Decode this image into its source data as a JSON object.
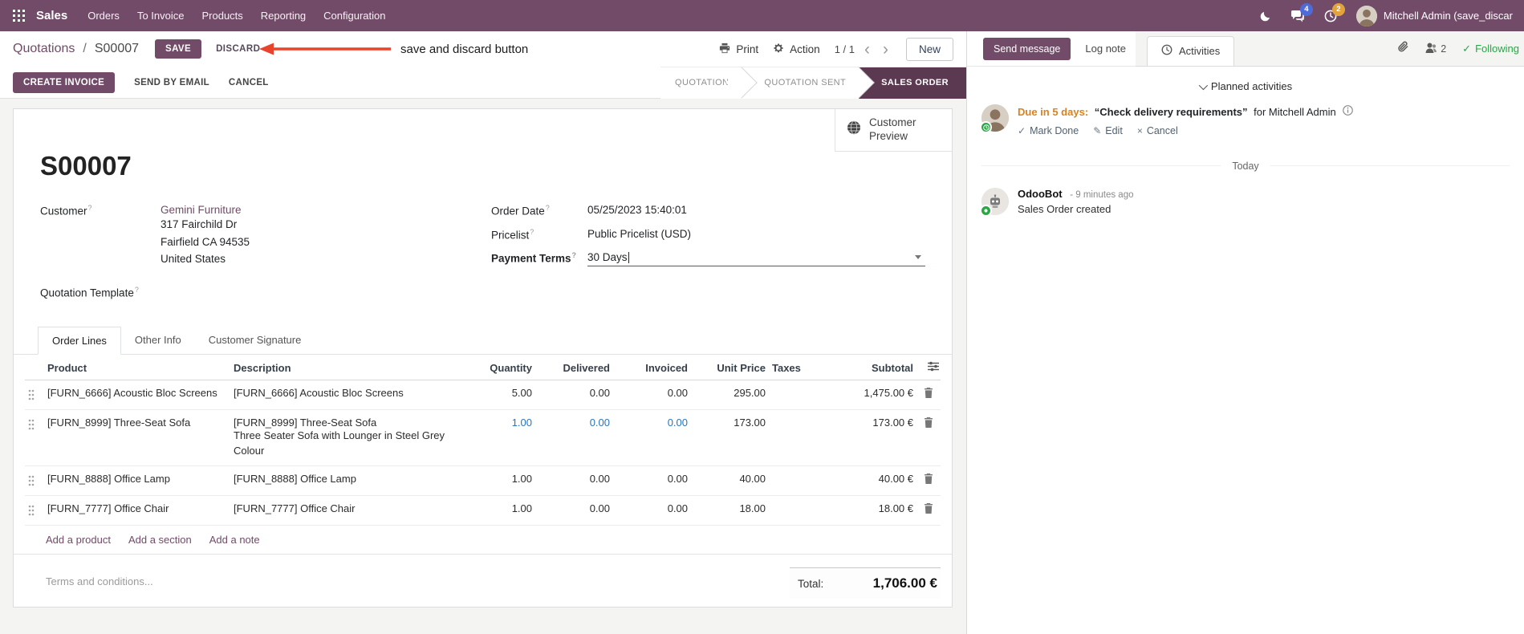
{
  "colors": {
    "brand": "#714B67",
    "brandDark": "#5B3A51",
    "link": "#714B67",
    "modifiedBlue": "#2A75BB",
    "dueOrange": "#D9831F",
    "successGreen": "#28A745",
    "annotationRed": "#E8432D",
    "badgeBlue": "#4E6BD8",
    "badgeOrange": "#E2A33D"
  },
  "nav": {
    "brand": "Sales",
    "menus": [
      "Orders",
      "To Invoice",
      "Products",
      "Reporting",
      "Configuration"
    ],
    "badges": {
      "messages": "4",
      "activities": "2"
    },
    "user": "Mitchell Admin (save_discar"
  },
  "control": {
    "breadcrumb_parent": "Quotations",
    "breadcrumb_sep": "/",
    "breadcrumb_current": "S00007",
    "save": "SAVE",
    "discard": "DISCARD",
    "annotation": "save and discard button",
    "print": "Print",
    "action": "Action",
    "pager": "1 / 1",
    "new": "New"
  },
  "statusbar": {
    "buttons": [
      "CREATE INVOICE",
      "SEND BY EMAIL",
      "CANCEL"
    ],
    "steps": [
      {
        "label": "QUOTATION",
        "active": false
      },
      {
        "label": "QUOTATION SENT",
        "active": false
      },
      {
        "label": "SALES ORDER",
        "active": true
      }
    ]
  },
  "sheet": {
    "customer_preview": "Customer Preview",
    "title": "S00007",
    "help_marker": "?",
    "customer_label": "Customer",
    "customer_name": "Gemini Furniture",
    "address": [
      "317 Fairchild Dr",
      "Fairfield CA 94535",
      "United States"
    ],
    "quotation_template_label": "Quotation Template",
    "order_date_label": "Order Date",
    "order_date": "05/25/2023 15:40:01",
    "pricelist_label": "Pricelist",
    "pricelist": "Public Pricelist (USD)",
    "payment_terms_label": "Payment Terms",
    "payment_terms": "30 Days",
    "tabs": [
      "Order Lines",
      "Other Info",
      "Customer Signature"
    ],
    "table": {
      "headers": [
        "Product",
        "Description",
        "Quantity",
        "Delivered",
        "Invoiced",
        "Unit Price",
        "Taxes",
        "Subtotal"
      ],
      "rows": [
        {
          "product": "[FURN_6666] Acoustic Bloc Screens",
          "description": "[FURN_6666] Acoustic Bloc Screens",
          "description2": "",
          "quantity": "5.00",
          "delivered": "0.00",
          "invoiced": "0.00",
          "unit_price": "295.00",
          "taxes": "",
          "subtotal": "1,475.00 €"
        },
        {
          "product": "[FURN_8999] Three-Seat Sofa",
          "description": "[FURN_8999] Three-Seat Sofa",
          "description2": "Three Seater Sofa with Lounger in Steel Grey Colour",
          "quantity": "1.00",
          "delivered": "0.00",
          "invoiced": "0.00",
          "unit_price": "173.00",
          "taxes": "",
          "subtotal": "173.00 €"
        },
        {
          "product": "[FURN_8888] Office Lamp",
          "description": "[FURN_8888] Office Lamp",
          "description2": "",
          "quantity": "1.00",
          "delivered": "0.00",
          "invoiced": "0.00",
          "unit_price": "40.00",
          "taxes": "",
          "subtotal": "40.00 €"
        },
        {
          "product": "[FURN_7777] Office Chair",
          "description": "[FURN_7777] Office Chair",
          "description2": "",
          "quantity": "1.00",
          "delivered": "0.00",
          "invoiced": "0.00",
          "unit_price": "18.00",
          "taxes": "",
          "subtotal": "18.00 €"
        }
      ],
      "links": [
        "Add a product",
        "Add a section",
        "Add a note"
      ]
    },
    "terms_placeholder": "Terms and conditions...",
    "total_label": "Total:",
    "total_value": "1,706.00 €"
  },
  "chatter": {
    "send_message": "Send message",
    "log_note": "Log note",
    "activities_tab": "Activities",
    "followers_count": "2",
    "following": "Following",
    "planned_header": "Planned activities",
    "activity": {
      "due": "Due in 5 days:",
      "summary": "“Check delivery requirements”",
      "for_text": "for Mitchell Admin",
      "mark_done": "Mark Done",
      "edit": "Edit",
      "cancel": "Cancel"
    },
    "today": "Today",
    "message": {
      "author": "OdooBot",
      "time": "- 9 minutes ago",
      "body": "Sales Order created"
    }
  }
}
